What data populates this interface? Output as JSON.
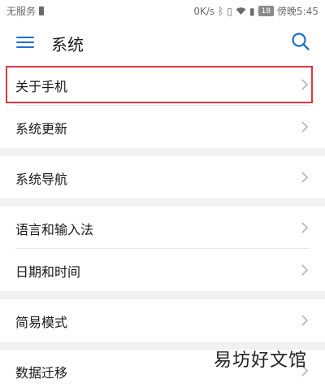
{
  "status_bar": {
    "carrier": "无服务",
    "speed": "0K/s",
    "battery_level": "18",
    "time": "傍晚5:45",
    "icons": [
      "bluetooth-icon",
      "vibrate-icon",
      "wifi-icon",
      "sim-icon",
      "battery-icon"
    ]
  },
  "header": {
    "title": "系统",
    "menu_icon": "hamburger-menu-icon",
    "search_icon": "search-icon"
  },
  "list": {
    "items": [
      {
        "label": "关于手机"
      },
      {
        "label": "系统更新"
      },
      {
        "label": "系统导航"
      },
      {
        "label": "语言和输入法"
      },
      {
        "label": "日期和时间"
      },
      {
        "label": "简易模式"
      },
      {
        "label": "数据迁移"
      }
    ]
  },
  "watermark": "易坊好文馆",
  "colors": {
    "accent": "#1f6fd1",
    "highlight": "#e0373f",
    "section_gap": "#f1f1f1"
  }
}
